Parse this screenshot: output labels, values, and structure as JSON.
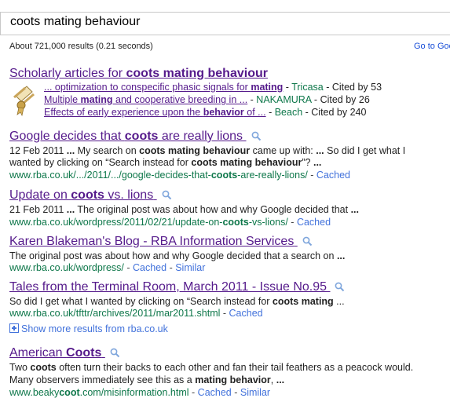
{
  "search": {
    "query": "coots mating behaviour"
  },
  "stats": {
    "text": "About 721,000 results (0.21 seconds)"
  },
  "goto_link": "Go to Goo",
  "scholar": {
    "title_prefix": "Scholarly articles for ",
    "title_query": "coots mating behaviour",
    "items": [
      {
        "pre": "... optimization to conspecific phasic signals for ",
        "bold": "mating",
        "post": "",
        "source": "Tricasa",
        "cited": "Cited by 53"
      },
      {
        "pre": "Multiple ",
        "bold": "mating",
        "post": " and cooperative breeding in ...",
        "source": "NAKAMURA",
        "cited": "Cited by 26"
      },
      {
        "pre": "Effects of early experience upon the ",
        "bold": "behavior",
        "post": " of ...",
        "source": "Beach",
        "cited": "Cited by 240"
      }
    ]
  },
  "results": [
    {
      "title": [
        "Google decides that ",
        "coots",
        " are really lions"
      ],
      "snippet1": [
        "12 Feb 2011 ",
        "...",
        " My search on ",
        "coots mating behaviour",
        " came up with: ",
        "...",
        " So did I get what I"
      ],
      "snippet2": [
        "wanted by clicking on “Search instead for ",
        "coots mating behaviour",
        "”? ",
        "..."
      ],
      "url": [
        "www.rba.co.uk/.../2011/.../google-decides-that-",
        "coots",
        "-are-really-lions/"
      ],
      "cached": "Cached"
    },
    {
      "title": [
        "Update on ",
        "coots",
        " vs. lions"
      ],
      "snippet1": [
        "21 Feb 2011 ",
        "...",
        " The original post was about how and why Google decided that ",
        "..."
      ],
      "url": [
        "www.rba.co.uk/wordpress/2011/02/21/update-on-",
        "coots",
        "-vs-lions/"
      ],
      "cached": "Cached"
    },
    {
      "title": [
        "Karen Blakeman's Blog - RBA Information Services"
      ],
      "snippet1": [
        "The original post was about how and why Google decided that a search on ",
        "..."
      ],
      "url": [
        "www.rba.co.uk/wordpress/"
      ],
      "cached": "Cached",
      "similar": "Similar"
    },
    {
      "title": [
        "Tales from the Terminal Room, March 2011 - Issue No.95"
      ],
      "snippet1": [
        "So did I get what I wanted by clicking on “Search instead for ",
        "coots mating",
        " ..."
      ],
      "url": [
        "www.rba.co.uk/tfttr/archives/2011/mar2011.shtml"
      ],
      "cached": "Cached"
    },
    {
      "title": [
        "American ",
        "Coots"
      ],
      "snippet1": [
        "Two ",
        "coots",
        " often turn their backs to each other and fan their tail feathers as a peacock would."
      ],
      "snippet2": [
        "Many observers immediately see this as a ",
        "mating behavior",
        ", ",
        "..."
      ],
      "url": [
        "www.beaky",
        "coot",
        ".com/misinformation.html"
      ],
      "cached": "Cached",
      "similar": "Similar"
    }
  ],
  "more_results": "Show more results from rba.co.uk",
  "separator": " - ",
  "icons": {
    "magnifier": "magnifier-icon",
    "scholar": "scroll-icon",
    "plus": "plus-box-icon"
  }
}
